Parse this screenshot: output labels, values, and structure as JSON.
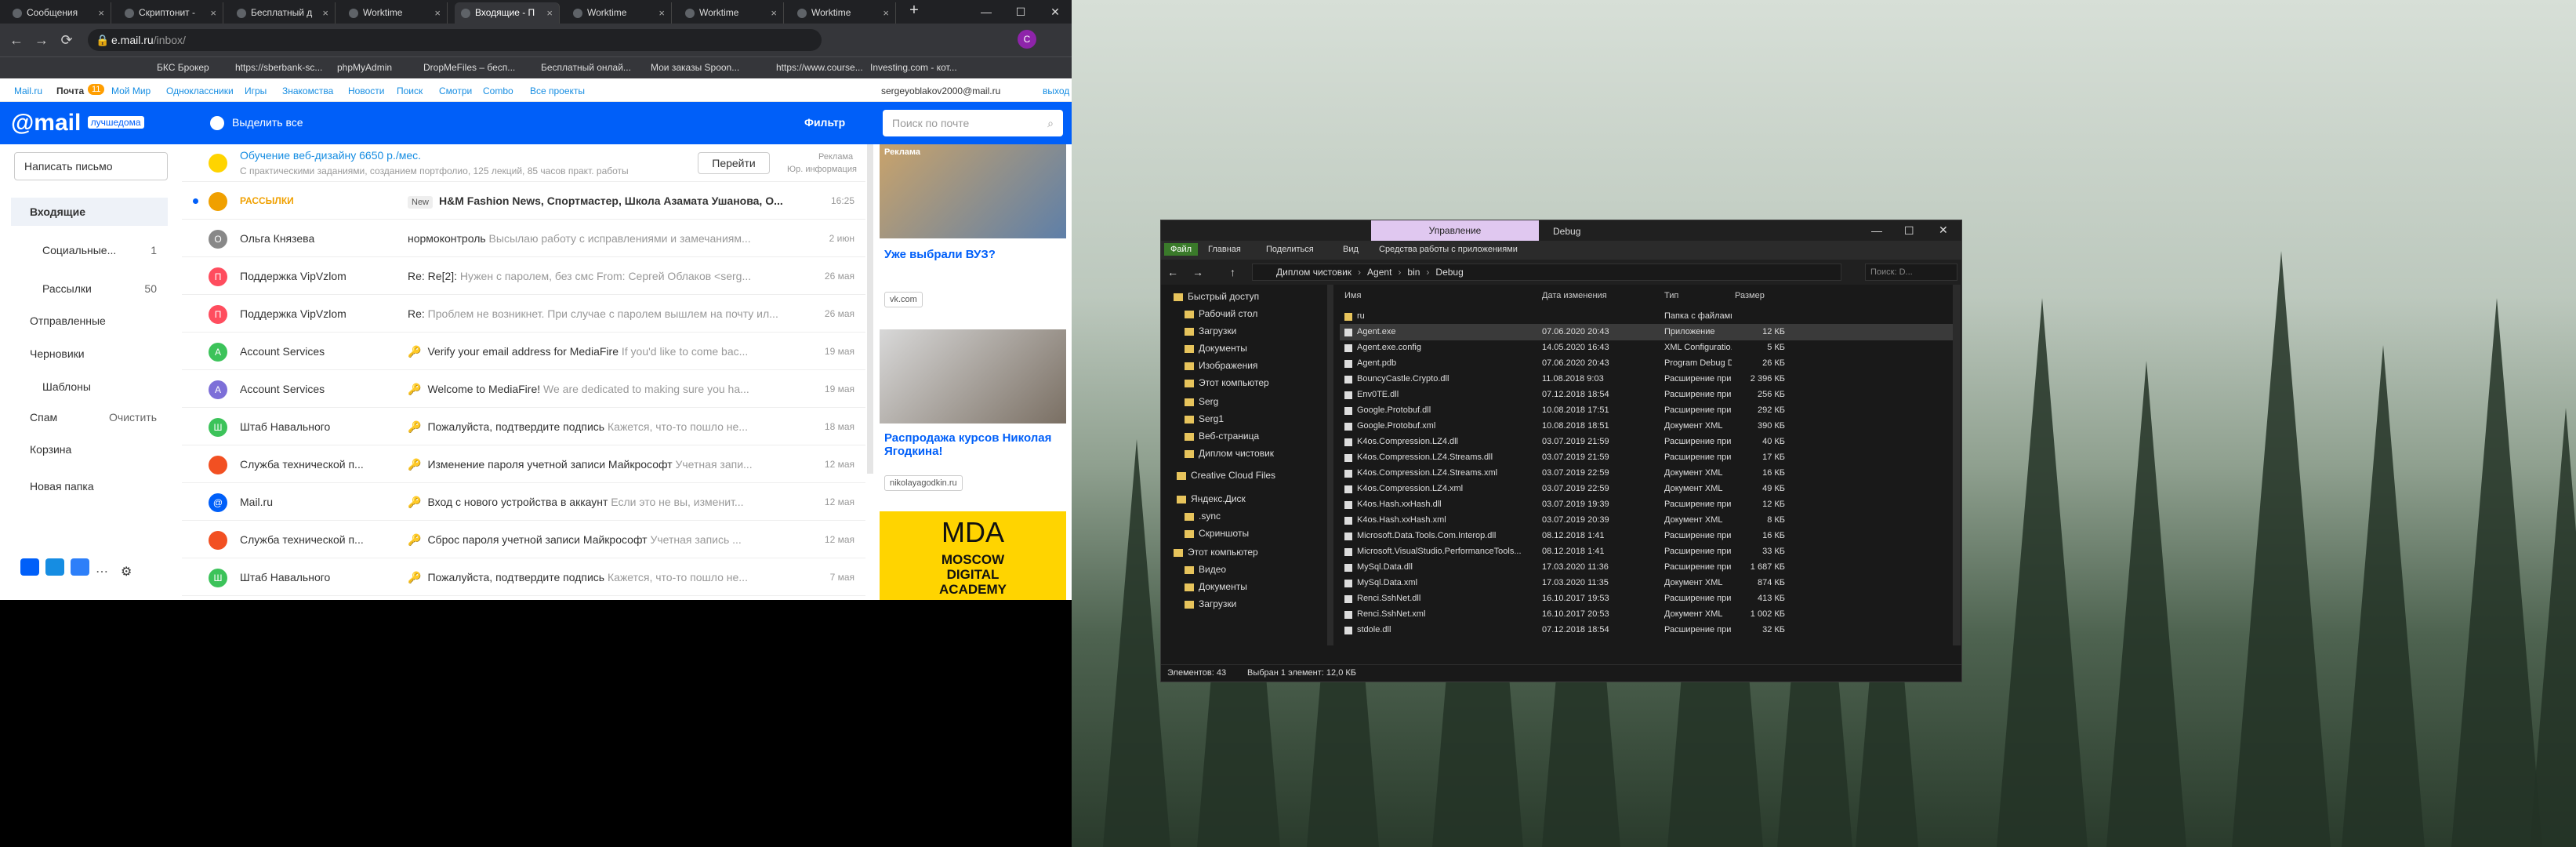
{
  "browser": {
    "tabs": [
      "Сообщения",
      "Скриптонит -",
      "Бесплатный д",
      "Worktime",
      "Входящие - П",
      "Worktime",
      "Worktime",
      "Worktime"
    ],
    "address_host": "e.mail.ru",
    "address_path": "/inbox/",
    "bookmarks": [
      "БКС Брокер",
      "https://sberbank-sc...",
      "phpMyAdmin",
      "DropMeFiles – бесп...",
      "Бесплатный онлай...",
      "Мои заказы Spoon...",
      "https://www.course...",
      "Investing.com - кот..."
    ]
  },
  "portal": {
    "links": [
      "Mail.ru",
      "Почта",
      "Мой Мир",
      "Одноклассники",
      "Игры",
      "Знакомства",
      "Новости",
      "Поиск",
      "Смотри",
      "Combo",
      "Все проекты"
    ],
    "mail_count": "11",
    "user": "sergeyoblakov2000@mail.ru",
    "logout": "выход"
  },
  "mail": {
    "logo": "mail",
    "logo_sub": "лучшедома",
    "select_all": "Выделить все",
    "filter": "Фильтр",
    "search_placeholder": "Поиск по почте",
    "compose": "Написать письмо",
    "folders": [
      {
        "label": "Входящие",
        "count": ""
      },
      {
        "label": "Социальные...",
        "count": "1"
      },
      {
        "label": "Рассылки",
        "count": "50"
      },
      {
        "label": "Отправленные",
        "count": ""
      },
      {
        "label": "Черновики",
        "count": ""
      },
      {
        "label": "Шаблоны",
        "count": ""
      },
      {
        "label": "Спам",
        "count": "Очистить"
      },
      {
        "label": "Корзина",
        "count": ""
      },
      {
        "label": "Новая папка",
        "count": ""
      }
    ],
    "promo": {
      "title": "Обучение веб-дизайну 6650 р./мес.",
      "text": "С практическими заданиями, созданием портфолио, 125 лекций, 85 часов практ. работы",
      "button": "Перейти",
      "ad_label": "Реклама",
      "legal": "Юр. информация"
    },
    "messages": [
      {
        "from": "РАССЫЛКИ",
        "subject": "H&M Fashion News, Спортмастер, Школа Азамата Ушанова, О...",
        "preview": "",
        "date": "16:25",
        "badge": "New",
        "avatar": "",
        "color": "#f0a000"
      },
      {
        "from": "Ольга Князева",
        "subject": "нормоконтроль",
        "preview": " Высылаю работу с исправлениями и замечаниям...",
        "date": "2 июн",
        "badge": "",
        "avatar": "О",
        "color": "#888888"
      },
      {
        "from": "Поддержка VipVzlom",
        "subject": "Re: Re[2]:",
        "preview": " Нужен с паролем, без смс From: Сергей Облаков <serg...",
        "date": "26 мая",
        "badge": "",
        "avatar": "П",
        "color": "#ff4d5e"
      },
      {
        "from": "Поддержка VipVzlom",
        "subject": "Re:",
        "preview": " Проблем не возникнет. При случае с паролем вышлем на почту ил...",
        "date": "26 мая",
        "badge": "",
        "avatar": "П",
        "color": "#ff4d5e"
      },
      {
        "from": "Account Services",
        "subject": "Verify your email address for MediaFire",
        "preview": " If you'd like to come bac...",
        "date": "19 мая",
        "badge": "",
        "avatar": "A",
        "color": "#3cc35a"
      },
      {
        "from": "Account Services",
        "subject": "Welcome to MediaFire!",
        "preview": " We are dedicated to making sure you ha...",
        "date": "19 мая",
        "badge": "",
        "avatar": "A",
        "color": "#7d6fd8"
      },
      {
        "from": "Штаб Навального",
        "subject": "Пожалуйста, подтвердите подпись",
        "preview": " Кажется, что-то пошло не...",
        "date": "18 мая",
        "badge": "",
        "avatar": "Ш",
        "color": "#3cc35a"
      },
      {
        "from": "Служба технической п...",
        "subject": "Изменение пароля учетной записи Майкрософт",
        "preview": " Учетная запи...",
        "date": "12 мая",
        "badge": "",
        "avatar": "",
        "color": "#f25022"
      },
      {
        "from": "Mail.ru",
        "subject": "Вход с нового устройства в аккаунт",
        "preview": " Если это не вы, изменит...",
        "date": "12 мая",
        "badge": "",
        "avatar": "@",
        "color": "#005ff9"
      },
      {
        "from": "Служба технической п...",
        "subject": "Сброс пароля учетной записи Майкрософт",
        "preview": " Учетная запись ...",
        "date": "12 мая",
        "badge": "",
        "avatar": "",
        "color": "#f25022"
      },
      {
        "from": "Штаб Навального",
        "subject": "Пожалуйста, подтвердите подпись",
        "preview": " Кажется, что-то пошло не...",
        "date": "7 мая",
        "badge": "",
        "avatar": "Ш",
        "color": "#3cc35a"
      }
    ],
    "ads": [
      {
        "label": "Реклама",
        "title": "Уже выбрали ВУЗ?",
        "button": "vk.com"
      },
      {
        "title": "Распродажа курсов Николая Ягодкина!",
        "button": "nikolayagodkin.ru"
      },
      {
        "text": "MOSCOW DIGITAL ACADEMY",
        "logo": "MDA"
      }
    ]
  },
  "explorer": {
    "context_tab": "Управление",
    "title": "Debug",
    "ribbon": [
      "Файл",
      "Главная",
      "Поделиться",
      "Вид",
      "Средства работы с приложениями"
    ],
    "path": [
      "Диплом чистовик",
      "Agent",
      "bin",
      "Debug"
    ],
    "search_placeholder": "Поиск: D...",
    "columns": [
      "Имя",
      "Дата изменения",
      "Тип",
      "Размер"
    ],
    "nav": [
      "Быстрый доступ",
      "Рабочий стол",
      "Загрузки",
      "Документы",
      "Изображения",
      "Этот компьютер",
      "Serg",
      "Serg1",
      "Веб-страница",
      "Диплом чистовик",
      "Creative Cloud Files",
      "Яндекс.Диск",
      ".sync",
      "Скриншоты",
      "Этот компьютер",
      "Видео",
      "Документы",
      "Загрузки"
    ],
    "files": [
      {
        "name": "ru",
        "date": "",
        "type": "Папка с файлами",
        "size": ""
      },
      {
        "name": "Agent.exe",
        "date": "07.06.2020 20:43",
        "type": "Приложение",
        "size": "12 КБ"
      },
      {
        "name": "Agent.exe.config",
        "date": "14.05.2020 16:43",
        "type": "XML Configuratio...",
        "size": "5 КБ"
      },
      {
        "name": "Agent.pdb",
        "date": "07.06.2020 20:43",
        "type": "Program Debug D...",
        "size": "26 КБ"
      },
      {
        "name": "BouncyCastle.Crypto.dll",
        "date": "11.08.2018 9:03",
        "type": "Расширение при...",
        "size": "2 396 КБ"
      },
      {
        "name": "Env0TE.dll",
        "date": "07.12.2018 18:54",
        "type": "Расширение при...",
        "size": "256 КБ"
      },
      {
        "name": "Google.Protobuf.dll",
        "date": "10.08.2018 17:51",
        "type": "Расширение при...",
        "size": "292 КБ"
      },
      {
        "name": "Google.Protobuf.xml",
        "date": "10.08.2018 18:51",
        "type": "Документ XML",
        "size": "390 КБ"
      },
      {
        "name": "K4os.Compression.LZ4.dll",
        "date": "03.07.2019 21:59",
        "type": "Расширение при...",
        "size": "40 КБ"
      },
      {
        "name": "K4os.Compression.LZ4.Streams.dll",
        "date": "03.07.2019 21:59",
        "type": "Расширение при...",
        "size": "17 КБ"
      },
      {
        "name": "K4os.Compression.LZ4.Streams.xml",
        "date": "03.07.2019 22:59",
        "type": "Документ XML",
        "size": "16 КБ"
      },
      {
        "name": "K4os.Compression.LZ4.xml",
        "date": "03.07.2019 22:59",
        "type": "Документ XML",
        "size": "49 КБ"
      },
      {
        "name": "K4os.Hash.xxHash.dll",
        "date": "03.07.2019 19:39",
        "type": "Расширение при...",
        "size": "12 КБ"
      },
      {
        "name": "K4os.Hash.xxHash.xml",
        "date": "03.07.2019 20:39",
        "type": "Документ XML",
        "size": "8 КБ"
      },
      {
        "name": "Microsoft.Data.Tools.Com.Interop.dll",
        "date": "08.12.2018 1:41",
        "type": "Расширение при...",
        "size": "16 КБ"
      },
      {
        "name": "Microsoft.VisualStudio.PerformanceTools...",
        "date": "08.12.2018 1:41",
        "type": "Расширение при...",
        "size": "33 КБ"
      },
      {
        "name": "MySql.Data.dll",
        "date": "17.03.2020 11:36",
        "type": "Расширение при...",
        "size": "1 687 КБ"
      },
      {
        "name": "MySql.Data.xml",
        "date": "17.03.2020 11:35",
        "type": "Документ XML",
        "size": "874 КБ"
      },
      {
        "name": "Renci.SshNet.dll",
        "date": "16.10.2017 19:53",
        "type": "Расширение при...",
        "size": "413 КБ"
      },
      {
        "name": "Renci.SshNet.xml",
        "date": "16.10.2017 20:53",
        "type": "Документ XML",
        "size": "1 002 КБ"
      },
      {
        "name": "stdole.dll",
        "date": "07.12.2018 18:54",
        "type": "Расширение при...",
        "size": "32 КБ"
      }
    ],
    "status_items": "Элементов: 43",
    "status_selected": "Выбран 1 элемент: 12,0 КБ"
  },
  "colors": {
    "mail_blue": "#005ff9",
    "explorer_bg": "#191919",
    "context_tab": "#e0c8f0"
  }
}
